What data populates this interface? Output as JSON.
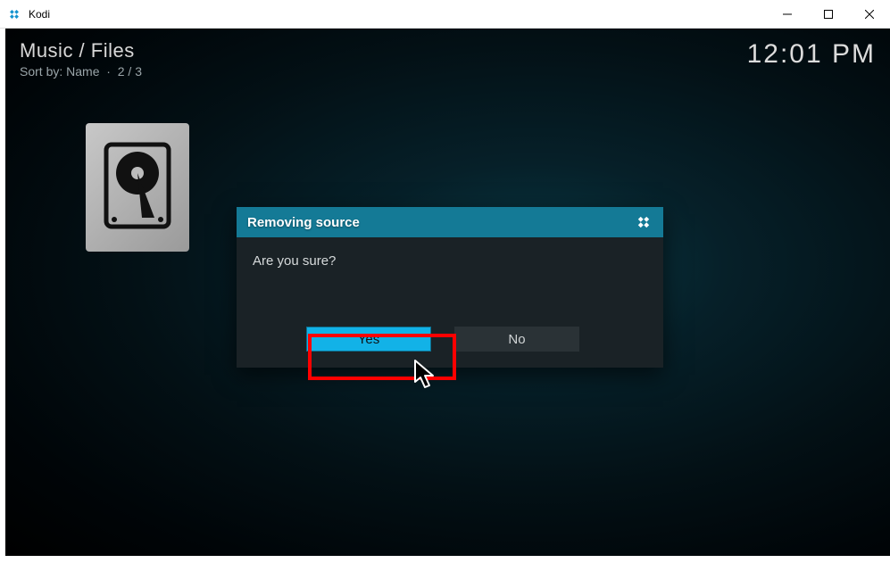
{
  "window": {
    "title": "Kodi"
  },
  "header": {
    "breadcrumb": "Music / Files",
    "sort_prefix": "Sort by: ",
    "sort_value": "Name",
    "count": "2 / 3"
  },
  "clock": "12:01 PM",
  "dialog": {
    "title": "Removing source",
    "message": "Are you sure?",
    "yes_label": "Yes",
    "no_label": "No"
  }
}
